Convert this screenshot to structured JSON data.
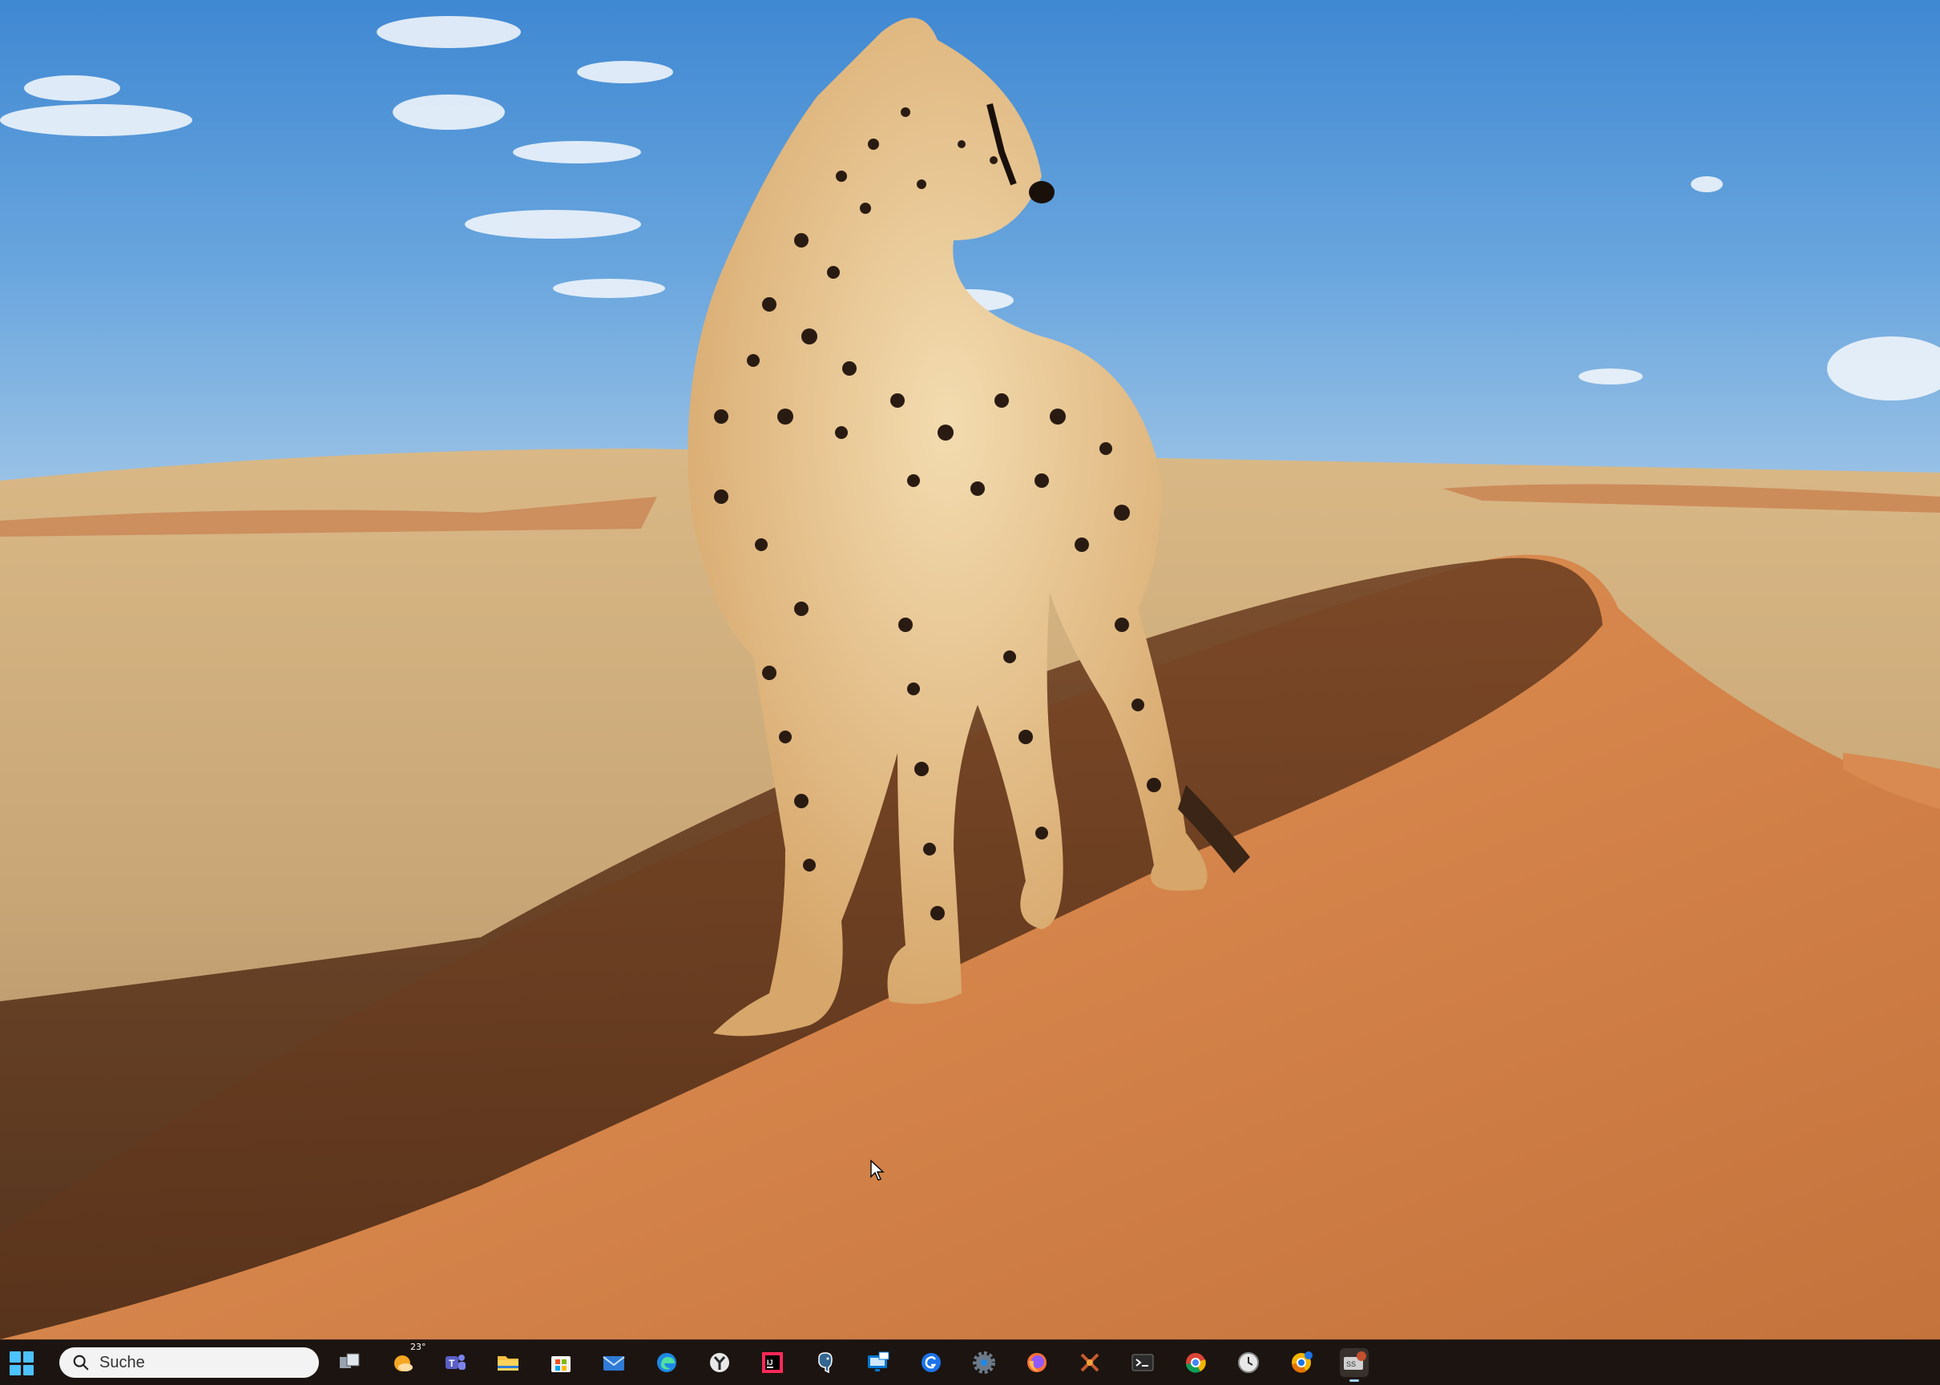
{
  "desktop": {
    "wallpaper": "cheetah standing on a desert sand dune under a blue sky"
  },
  "taskbar": {
    "start_icon": "windows-start-icon",
    "search": {
      "icon": "search-icon",
      "label": "Suche"
    },
    "weather": {
      "icon": "weather-icon",
      "temperature": "23°"
    },
    "apps": [
      {
        "name": "task-view-icon"
      },
      {
        "name": "weather-widget-icon"
      },
      {
        "name": "teams-icon"
      },
      {
        "name": "file-explorer-icon"
      },
      {
        "name": "microsoft-store-icon"
      },
      {
        "name": "mail-icon"
      },
      {
        "name": "edge-icon"
      },
      {
        "name": "app-icon-y"
      },
      {
        "name": "intellij-icon"
      },
      {
        "name": "postgresql-icon"
      },
      {
        "name": "remote-desktop-icon"
      },
      {
        "name": "grammarly-icon"
      },
      {
        "name": "settings-icon"
      },
      {
        "name": "firefox-icon"
      },
      {
        "name": "tool-icon"
      },
      {
        "name": "terminal-icon"
      },
      {
        "name": "chrome-icon"
      },
      {
        "name": "clock-icon"
      },
      {
        "name": "chrome-canary-icon"
      },
      {
        "name": "active-app-icon"
      }
    ]
  },
  "colors": {
    "taskbar_bg": "#1c1410",
    "windows_blue": "#4cc2ff",
    "sky": "#5a9ad6",
    "sand": "#d9894a"
  }
}
